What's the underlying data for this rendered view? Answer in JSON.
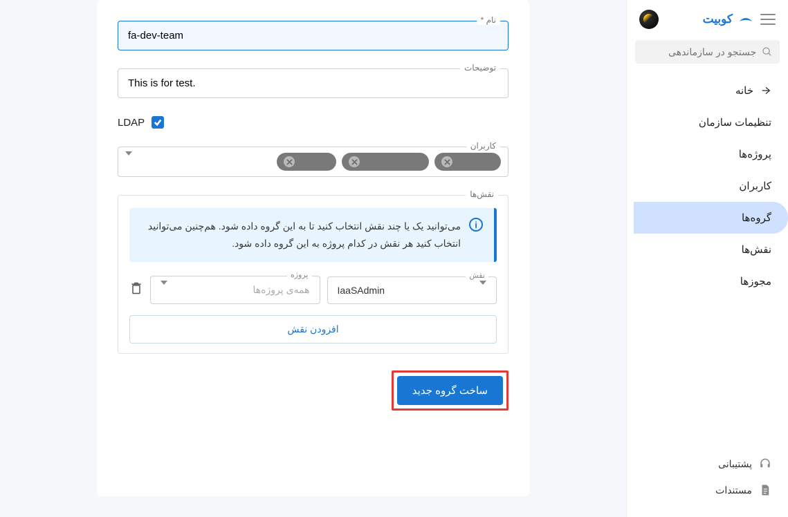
{
  "brand": "کوبیت",
  "search": {
    "placeholder": "جستجو در سازماندهی"
  },
  "nav": {
    "home": "خانه",
    "org_settings": "تنظیمات سازمان",
    "projects": "پروژه‌ها",
    "users": "کاربران",
    "groups": "گروه‌ها",
    "roles": "نقش‌ها",
    "licenses": "مجوزها"
  },
  "footer": {
    "support": "پشتیبانی",
    "docs": "مستندات"
  },
  "form": {
    "name_label": "نام *",
    "name_value": "fa-dev-team",
    "desc_label": "توضیحات",
    "desc_value": "This is for test.",
    "ldap_label": "LDAP",
    "users_label": "کاربران",
    "roles_legend": "نقش‌ها",
    "info_text": "می‌توانید یک یا چند نقش انتخاب کنید تا به این گروه داده شود. هم‌چنین می‌توانید انتخاب کنید هر نقش در کدام پروژه به این گروه داده شود.",
    "role_label": "نقش",
    "role_value": "IaaSAdmin",
    "project_label": "پروژه",
    "project_placeholder": "همه‌ی پروژه‌ها",
    "add_role": "افزودن نقش",
    "submit": "ساخت گروه جدید"
  }
}
